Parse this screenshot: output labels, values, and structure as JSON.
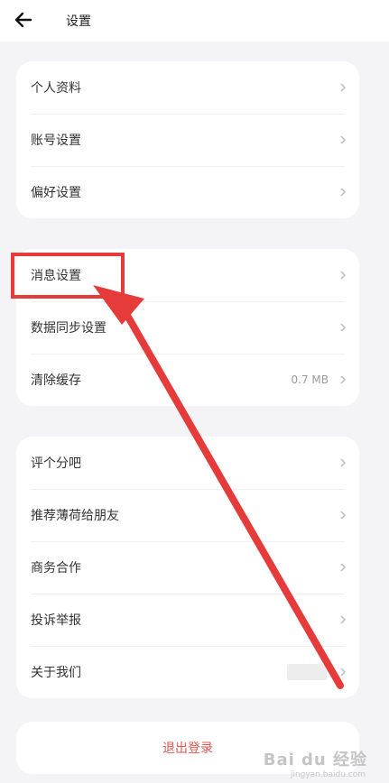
{
  "header": {
    "title": "设置"
  },
  "group1": [
    {
      "label": "个人资料"
    },
    {
      "label": "账号设置"
    },
    {
      "label": "偏好设置"
    }
  ],
  "group2": [
    {
      "label": "消息设置"
    },
    {
      "label": "数据同步设置"
    },
    {
      "label": "清除缓存",
      "value": "0.7 MB"
    }
  ],
  "group3": [
    {
      "label": "评个分吧"
    },
    {
      "label": "推荐薄荷给朋友"
    },
    {
      "label": "商务合作"
    },
    {
      "label": "投诉举报"
    },
    {
      "label": "关于我们"
    }
  ],
  "logout": {
    "label": "退出登录"
  },
  "watermark": {
    "brand": "Bai du 经验",
    "url": "jingyan.baidu.com"
  },
  "colors": {
    "highlight": "#e63b3b",
    "logout": "#e0574f"
  }
}
